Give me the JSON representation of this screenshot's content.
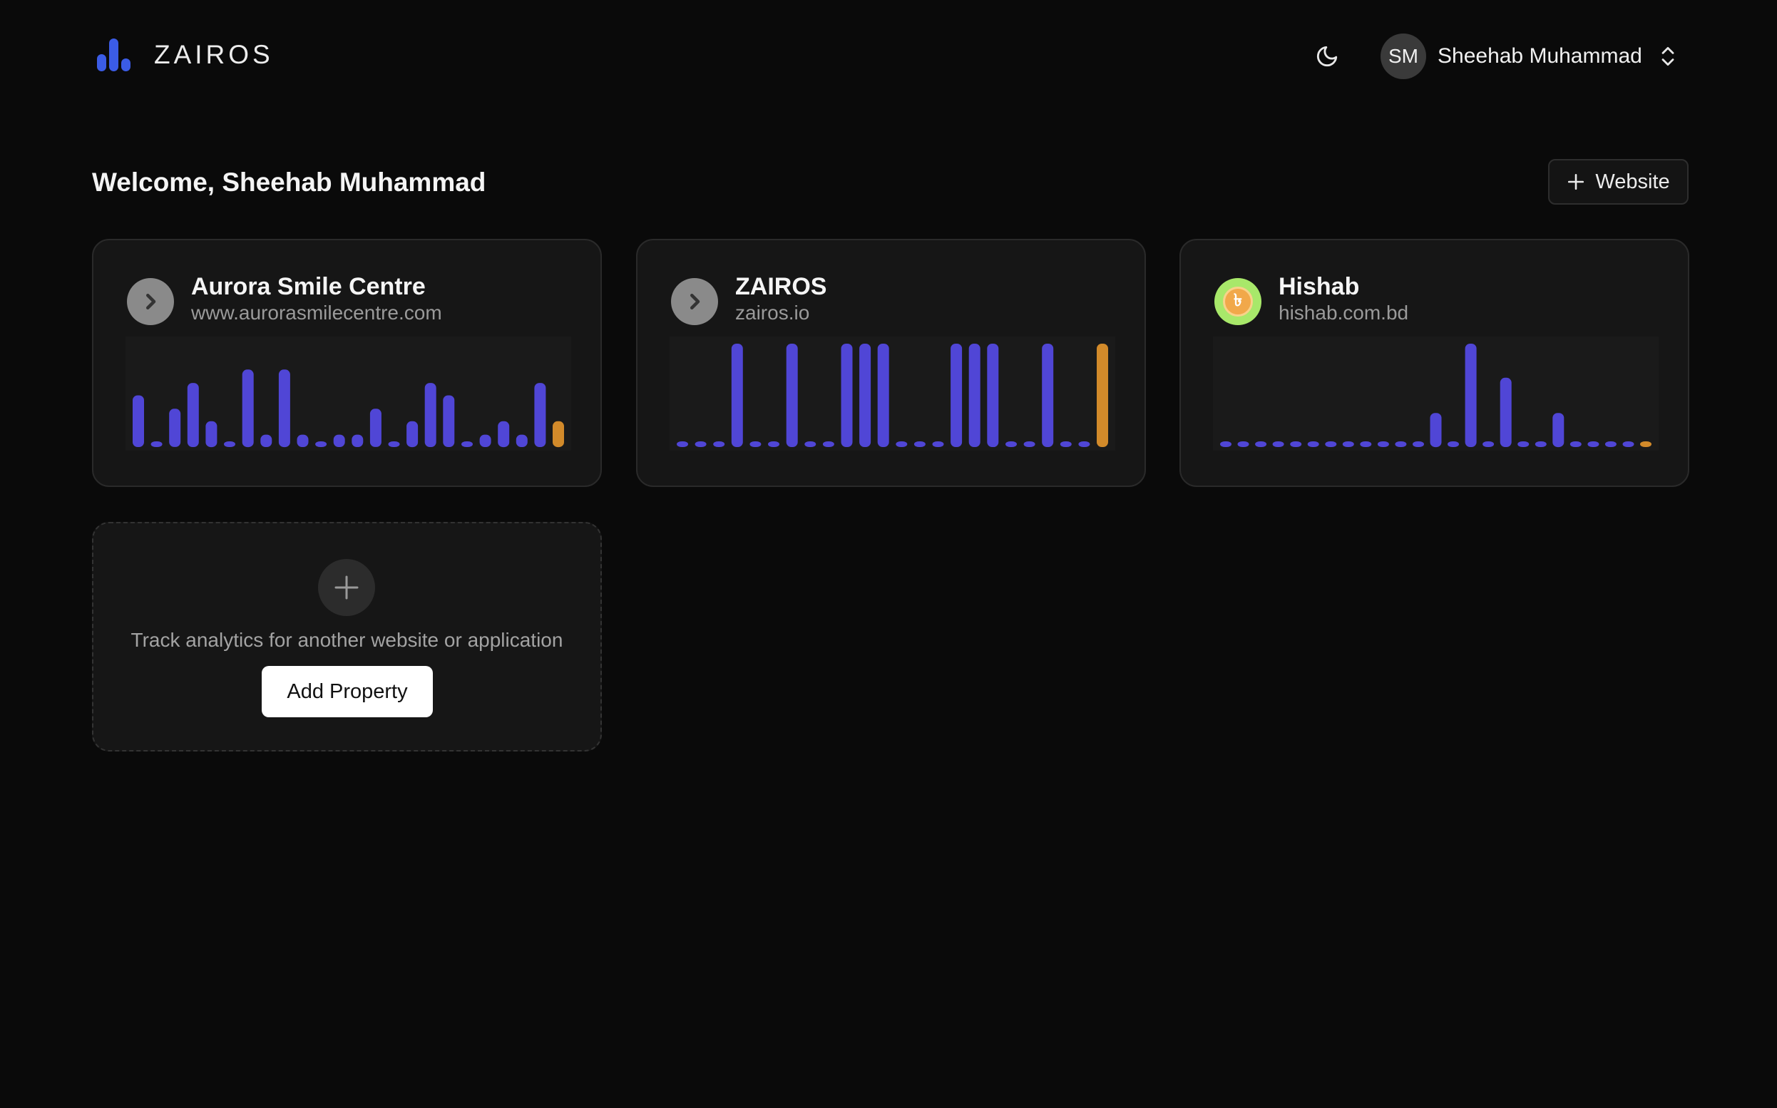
{
  "header": {
    "brand": "ZAIROS",
    "user": {
      "initials": "SM",
      "name": "Sheehab Muhammad"
    }
  },
  "main": {
    "welcome": "Welcome, Sheehab Muhammad",
    "add_website_label": "Website"
  },
  "properties": [
    {
      "name": "Aurora Smile Centre",
      "domain": "www.aurorasmilecentre.com",
      "favicon": "chevron-right-icon",
      "chart_levels": [
        0.5,
        0.0,
        0.37,
        0.62,
        0.25,
        0.0,
        0.75,
        0.12,
        0.75,
        0.12,
        0.0,
        0.12,
        0.12,
        0.37,
        0.0,
        0.25,
        0.62,
        0.5,
        0.0,
        0.12,
        0.25,
        0.12,
        0.62,
        0.25
      ]
    },
    {
      "name": "ZAIROS",
      "domain": "zairos.io",
      "favicon": "chevron-right-icon",
      "chart_levels": [
        0,
        0,
        0,
        1,
        0,
        0,
        1,
        0,
        0,
        1,
        1,
        1,
        0,
        0,
        0,
        1,
        1,
        1,
        0,
        0,
        1,
        0,
        0,
        1
      ]
    },
    {
      "name": "Hishab",
      "domain": "hishab.com.bd",
      "favicon": "coin-icon",
      "chart_levels": [
        0,
        0,
        0,
        0,
        0,
        0,
        0,
        0,
        0,
        0,
        0,
        0,
        0.33,
        0,
        1,
        0,
        0.67,
        0,
        0,
        0.33,
        0,
        0,
        0,
        0,
        0
      ]
    }
  ],
  "add_property": {
    "text": "Track analytics for another website or application",
    "button_label": "Add Property"
  },
  "colors": {
    "bar": "#5046d6",
    "bar_current": "#d28a2a",
    "background": "#0a0a0a",
    "card": "#161616",
    "logo": "#3b5ce6"
  }
}
